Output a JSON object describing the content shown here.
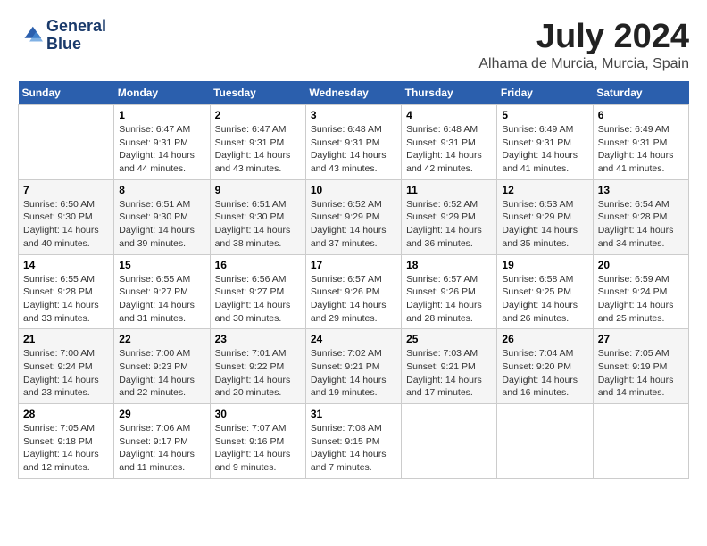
{
  "logo": {
    "line1": "General",
    "line2": "Blue"
  },
  "title": {
    "month_year": "July 2024",
    "location": "Alhama de Murcia, Murcia, Spain"
  },
  "days_of_week": [
    "Sunday",
    "Monday",
    "Tuesday",
    "Wednesday",
    "Thursday",
    "Friday",
    "Saturday"
  ],
  "weeks": [
    [
      {
        "day": "",
        "info": ""
      },
      {
        "day": "1",
        "info": "Sunrise: 6:47 AM\nSunset: 9:31 PM\nDaylight: 14 hours\nand 44 minutes."
      },
      {
        "day": "2",
        "info": "Sunrise: 6:47 AM\nSunset: 9:31 PM\nDaylight: 14 hours\nand 43 minutes."
      },
      {
        "day": "3",
        "info": "Sunrise: 6:48 AM\nSunset: 9:31 PM\nDaylight: 14 hours\nand 43 minutes."
      },
      {
        "day": "4",
        "info": "Sunrise: 6:48 AM\nSunset: 9:31 PM\nDaylight: 14 hours\nand 42 minutes."
      },
      {
        "day": "5",
        "info": "Sunrise: 6:49 AM\nSunset: 9:31 PM\nDaylight: 14 hours\nand 41 minutes."
      },
      {
        "day": "6",
        "info": "Sunrise: 6:49 AM\nSunset: 9:31 PM\nDaylight: 14 hours\nand 41 minutes."
      }
    ],
    [
      {
        "day": "7",
        "info": "Sunrise: 6:50 AM\nSunset: 9:30 PM\nDaylight: 14 hours\nand 40 minutes."
      },
      {
        "day": "8",
        "info": "Sunrise: 6:51 AM\nSunset: 9:30 PM\nDaylight: 14 hours\nand 39 minutes."
      },
      {
        "day": "9",
        "info": "Sunrise: 6:51 AM\nSunset: 9:30 PM\nDaylight: 14 hours\nand 38 minutes."
      },
      {
        "day": "10",
        "info": "Sunrise: 6:52 AM\nSunset: 9:29 PM\nDaylight: 14 hours\nand 37 minutes."
      },
      {
        "day": "11",
        "info": "Sunrise: 6:52 AM\nSunset: 9:29 PM\nDaylight: 14 hours\nand 36 minutes."
      },
      {
        "day": "12",
        "info": "Sunrise: 6:53 AM\nSunset: 9:29 PM\nDaylight: 14 hours\nand 35 minutes."
      },
      {
        "day": "13",
        "info": "Sunrise: 6:54 AM\nSunset: 9:28 PM\nDaylight: 14 hours\nand 34 minutes."
      }
    ],
    [
      {
        "day": "14",
        "info": "Sunrise: 6:55 AM\nSunset: 9:28 PM\nDaylight: 14 hours\nand 33 minutes."
      },
      {
        "day": "15",
        "info": "Sunrise: 6:55 AM\nSunset: 9:27 PM\nDaylight: 14 hours\nand 31 minutes."
      },
      {
        "day": "16",
        "info": "Sunrise: 6:56 AM\nSunset: 9:27 PM\nDaylight: 14 hours\nand 30 minutes."
      },
      {
        "day": "17",
        "info": "Sunrise: 6:57 AM\nSunset: 9:26 PM\nDaylight: 14 hours\nand 29 minutes."
      },
      {
        "day": "18",
        "info": "Sunrise: 6:57 AM\nSunset: 9:26 PM\nDaylight: 14 hours\nand 28 minutes."
      },
      {
        "day": "19",
        "info": "Sunrise: 6:58 AM\nSunset: 9:25 PM\nDaylight: 14 hours\nand 26 minutes."
      },
      {
        "day": "20",
        "info": "Sunrise: 6:59 AM\nSunset: 9:24 PM\nDaylight: 14 hours\nand 25 minutes."
      }
    ],
    [
      {
        "day": "21",
        "info": "Sunrise: 7:00 AM\nSunset: 9:24 PM\nDaylight: 14 hours\nand 23 minutes."
      },
      {
        "day": "22",
        "info": "Sunrise: 7:00 AM\nSunset: 9:23 PM\nDaylight: 14 hours\nand 22 minutes."
      },
      {
        "day": "23",
        "info": "Sunrise: 7:01 AM\nSunset: 9:22 PM\nDaylight: 14 hours\nand 20 minutes."
      },
      {
        "day": "24",
        "info": "Sunrise: 7:02 AM\nSunset: 9:21 PM\nDaylight: 14 hours\nand 19 minutes."
      },
      {
        "day": "25",
        "info": "Sunrise: 7:03 AM\nSunset: 9:21 PM\nDaylight: 14 hours\nand 17 minutes."
      },
      {
        "day": "26",
        "info": "Sunrise: 7:04 AM\nSunset: 9:20 PM\nDaylight: 14 hours\nand 16 minutes."
      },
      {
        "day": "27",
        "info": "Sunrise: 7:05 AM\nSunset: 9:19 PM\nDaylight: 14 hours\nand 14 minutes."
      }
    ],
    [
      {
        "day": "28",
        "info": "Sunrise: 7:05 AM\nSunset: 9:18 PM\nDaylight: 14 hours\nand 12 minutes."
      },
      {
        "day": "29",
        "info": "Sunrise: 7:06 AM\nSunset: 9:17 PM\nDaylight: 14 hours\nand 11 minutes."
      },
      {
        "day": "30",
        "info": "Sunrise: 7:07 AM\nSunset: 9:16 PM\nDaylight: 14 hours\nand 9 minutes."
      },
      {
        "day": "31",
        "info": "Sunrise: 7:08 AM\nSunset: 9:15 PM\nDaylight: 14 hours\nand 7 minutes."
      },
      {
        "day": "",
        "info": ""
      },
      {
        "day": "",
        "info": ""
      },
      {
        "day": "",
        "info": ""
      }
    ]
  ]
}
